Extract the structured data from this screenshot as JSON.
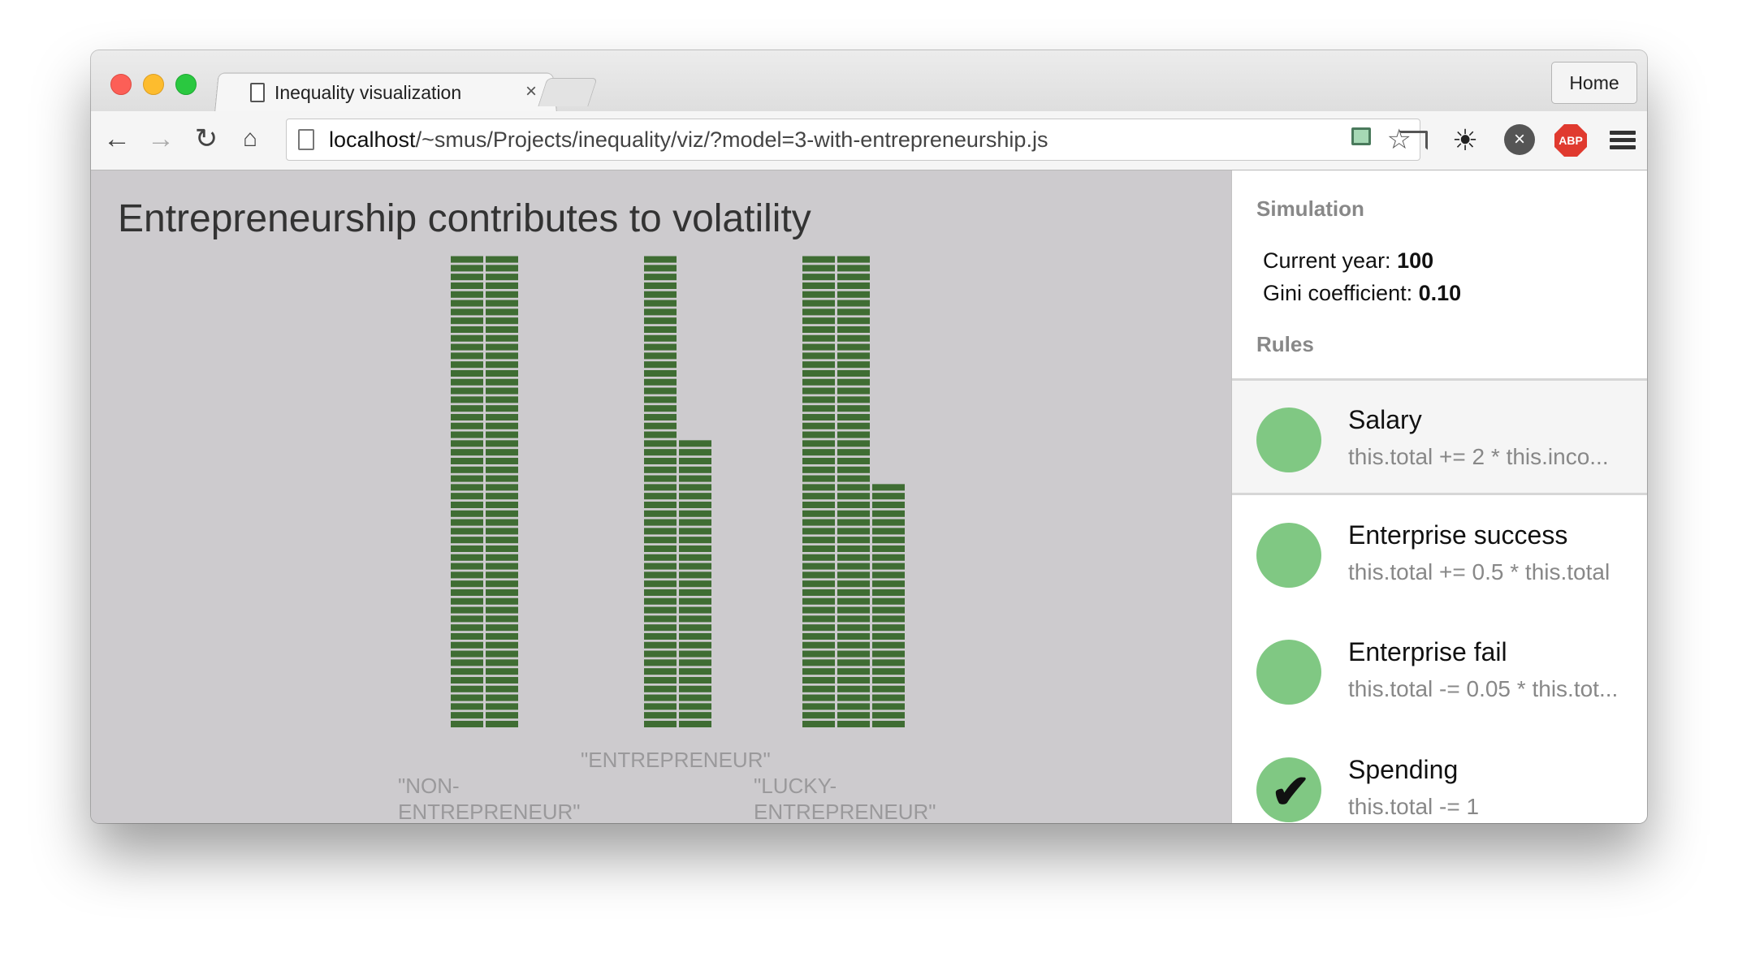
{
  "browser": {
    "tab_title": "Inequality visualization",
    "tab_close": "×",
    "home_button": "Home",
    "url_host": "localhost",
    "url_path": "/~smus/Projects/inequality/viz/?model=3-with-entrepreneurship.js",
    "extensions": [
      "screenshot-extension-icon",
      "cast-icon",
      "lightbulb-icon",
      "close-circle-icon",
      "adblock-icon",
      "menu-icon"
    ],
    "abp_label": "ABP"
  },
  "viz": {
    "title": "Entrepreneurship contributes to volatility",
    "people": [
      {
        "label_lines": [
          "\"NON-",
          "ENTREPRENEUR\""
        ],
        "columns": [
          54,
          54
        ],
        "color": "#3f6d33"
      },
      {
        "label_lines": [
          "\"ENTREPRENEUR\""
        ],
        "columns": [
          54,
          33
        ],
        "color": "#3f6d33"
      },
      {
        "label_lines": [
          "\"LUCKY-",
          "ENTREPRENEUR\""
        ],
        "columns": [
          54,
          54,
          28
        ],
        "color": "#3f6d33"
      }
    ]
  },
  "sidebar": {
    "simulation_heading": "Simulation",
    "current_year_label": "Current year: ",
    "current_year_value": "100",
    "gini_label": "Gini coefficient: ",
    "gini_value": "0.10",
    "rules_heading": "Rules",
    "rules": [
      {
        "name": "Salary",
        "code": "this.total += 2 * this.inco...",
        "checked": false
      },
      {
        "name": "Enterprise success",
        "code": "this.total += 0.5 * this.total",
        "checked": false
      },
      {
        "name": "Enterprise fail",
        "code": "this.total -= 0.05 * this.tot...",
        "checked": false
      },
      {
        "name": "Spending",
        "code": "this.total -= 1",
        "checked": true
      }
    ],
    "rule_circle_color": "#80c883"
  }
}
